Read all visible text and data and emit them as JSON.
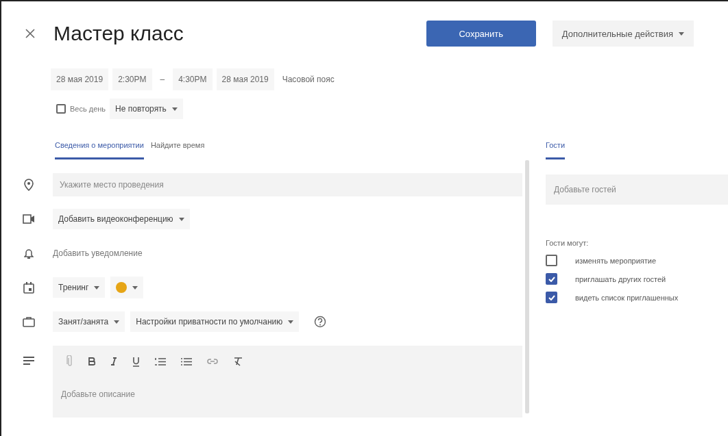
{
  "title": "Мастер класс",
  "save_button": "Сохранить",
  "more_actions": "Дополнительные действия",
  "date_row": [
    {
      "kind": "field",
      "text": "28 мая 2019"
    },
    {
      "kind": "field",
      "text": "2:30PM"
    },
    {
      "kind": "dash",
      "text": "–"
    },
    {
      "kind": "field",
      "text": "4:30PM"
    },
    {
      "kind": "field",
      "text": "28 мая 2019"
    },
    {
      "kind": "link",
      "text": "Часовой пояс"
    }
  ],
  "all_day": {
    "label": "Весь день",
    "checked": false
  },
  "repeat": "Не повторять",
  "tabs": [
    {
      "label": "Сведения о мероприятии",
      "selected": true
    },
    {
      "label": "Найдите время",
      "selected": false
    }
  ],
  "location": {
    "placeholder": "Укажите место проведения"
  },
  "video": "Добавить видеоконференцию",
  "notification": "Добавить уведомление",
  "calendar": {
    "name": "Тренинг",
    "color": "#e6a516"
  },
  "availability": "Занят/занята",
  "privacy": "Настройки приватности по умолчанию",
  "description": {
    "placeholder": "Добавьте описание"
  },
  "guests": {
    "tab": {
      "label": "Гости",
      "selected": true
    },
    "field": {
      "placeholder": "Добавьте гостей"
    },
    "permissions_title": "Гости могут:",
    "permissions": [
      {
        "label": "изменять мероприятие",
        "checked": false
      },
      {
        "label": "приглашать других гостей",
        "checked": true
      },
      {
        "label": "видеть список приглашенных",
        "checked": true
      }
    ]
  }
}
